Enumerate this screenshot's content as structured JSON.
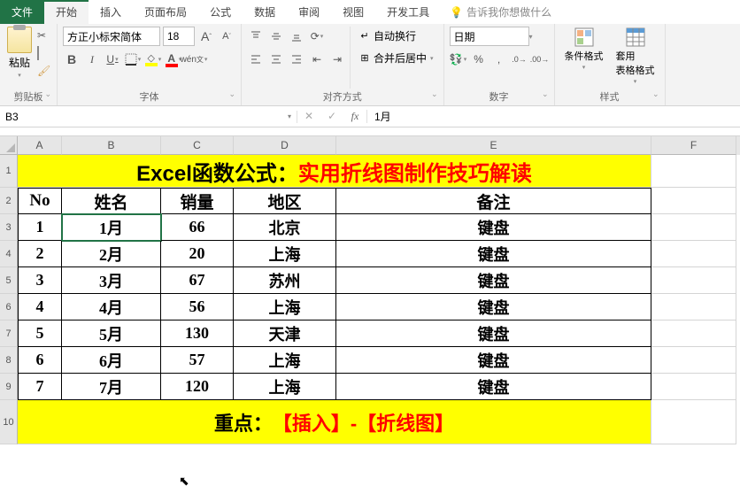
{
  "tabs": {
    "file": "文件",
    "home": "开始",
    "insert": "插入",
    "pageLayout": "页面布局",
    "formulas": "公式",
    "data": "数据",
    "review": "审阅",
    "view": "视图",
    "dev": "开发工具",
    "tellMe": "告诉我你想做什么"
  },
  "ribbon": {
    "clipboard": {
      "label": "剪贴板",
      "paste": "粘贴"
    },
    "font": {
      "label": "字体",
      "name": "方正小标宋简体",
      "size": "18",
      "increaseA": "A",
      "decreaseA": "A",
      "bold": "B",
      "italic": "I",
      "underline": "U"
    },
    "alignment": {
      "label": "对齐方式",
      "wrap": "自动换行",
      "merge": "合并后居中"
    },
    "number": {
      "label": "数字",
      "format": "日期"
    },
    "styles": {
      "label": "样式",
      "conditional": "条件格式",
      "table": "套用\n表格格式"
    }
  },
  "nameBox": "B3",
  "formulaValue": "1月",
  "colHeaders": [
    "A",
    "B",
    "C",
    "D",
    "E",
    "F"
  ],
  "rowHeaders": [
    "1",
    "2",
    "3",
    "4",
    "5",
    "6",
    "7",
    "8",
    "9",
    "10"
  ],
  "titleRow": {
    "part1": "Excel函数公式：",
    "part2": "实用折线图制作技巧解读"
  },
  "headerRow": {
    "no": "No",
    "name": "姓名",
    "sales": "销量",
    "region": "地区",
    "note": "备注"
  },
  "dataRows": [
    {
      "no": "1",
      "name": "1月",
      "sales": "66",
      "region": "北京",
      "note": "键盘"
    },
    {
      "no": "2",
      "name": "2月",
      "sales": "20",
      "region": "上海",
      "note": "键盘"
    },
    {
      "no": "3",
      "name": "3月",
      "sales": "67",
      "region": "苏州",
      "note": "键盘"
    },
    {
      "no": "4",
      "name": "4月",
      "sales": "56",
      "region": "上海",
      "note": "键盘"
    },
    {
      "no": "5",
      "name": "5月",
      "sales": "130",
      "region": "天津",
      "note": "键盘"
    },
    {
      "no": "6",
      "name": "6月",
      "sales": "57",
      "region": "上海",
      "note": "键盘"
    },
    {
      "no": "7",
      "name": "7月",
      "sales": "120",
      "region": "上海",
      "note": "键盘"
    }
  ],
  "footerRow": {
    "part1": "重点：",
    "part2": "【插入】-【折线图】"
  }
}
